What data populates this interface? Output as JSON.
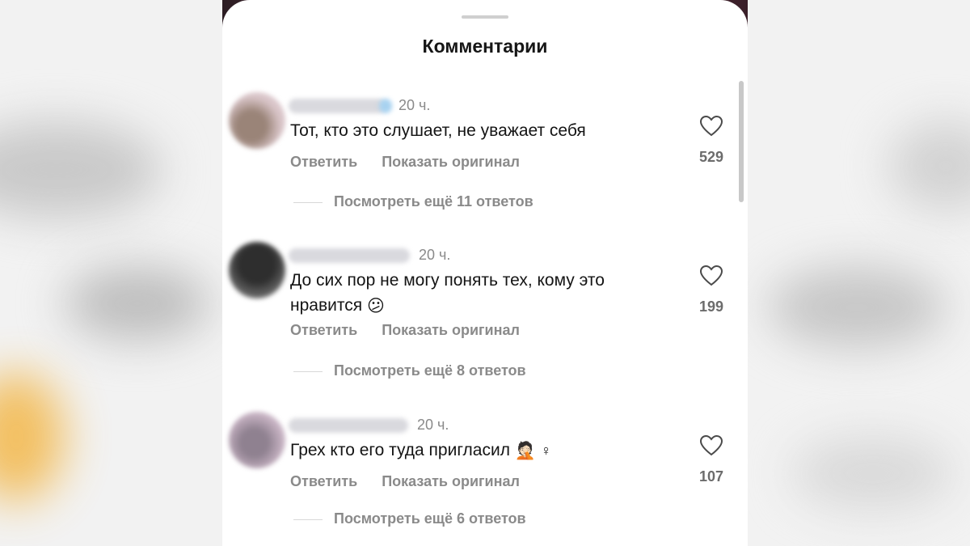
{
  "sheet": {
    "title": "Комментарии"
  },
  "comments": [
    {
      "time": "20 ч.",
      "text": "Тот, кто это слушает, не уважает себя",
      "reply_label": "Ответить",
      "translate_label": "Показать оригинал",
      "likes": "529",
      "more_replies": "Посмотреть ещё 11 ответов",
      "avatar_color": "#c9b6b8"
    },
    {
      "time": "20 ч.",
      "text_line1": "До сих пор не могу понять тех, кому это",
      "text_line2": "нравится",
      "emoji": "😕",
      "reply_label": "Ответить",
      "translate_label": "Показать оригинал",
      "likes": "199",
      "more_replies": "Посмотреть ещё 8 ответов",
      "avatar_color": "#3a3a3a"
    },
    {
      "time": "20 ч.",
      "text": "Грех кто его туда пригласил",
      "emoji": "🤦🏻",
      "emoji2": "♀",
      "reply_label": "Ответить",
      "translate_label": "Показать оригинал",
      "likes": "107",
      "more_replies": "Посмотреть ещё 6 ответов",
      "avatar_color": "#c7b3c3"
    }
  ],
  "icons": {
    "like": "heart-outline-icon"
  }
}
